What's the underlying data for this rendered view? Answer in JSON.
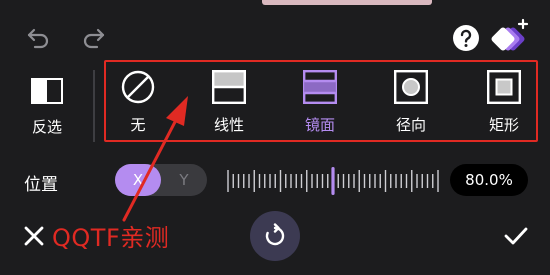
{
  "invert": {
    "label": "反选"
  },
  "masks": [
    {
      "label": "无",
      "icon": "none-icon"
    },
    {
      "label": "线性",
      "icon": "linear-icon"
    },
    {
      "label": "镜面",
      "icon": "mirror-icon"
    },
    {
      "label": "径向",
      "icon": "radial-icon"
    },
    {
      "label": "矩形",
      "icon": "rectangle-icon"
    }
  ],
  "selected_mask": "镜面",
  "position": {
    "label": "位置",
    "axis_x": "X",
    "axis_y": "Y",
    "selected_axis": "X",
    "value": "80.0%"
  },
  "watermark": "QQTF亲测",
  "colors": {
    "background": "#1c1c1e",
    "accent": "#b48cf0",
    "annotation": "#e02a23"
  }
}
